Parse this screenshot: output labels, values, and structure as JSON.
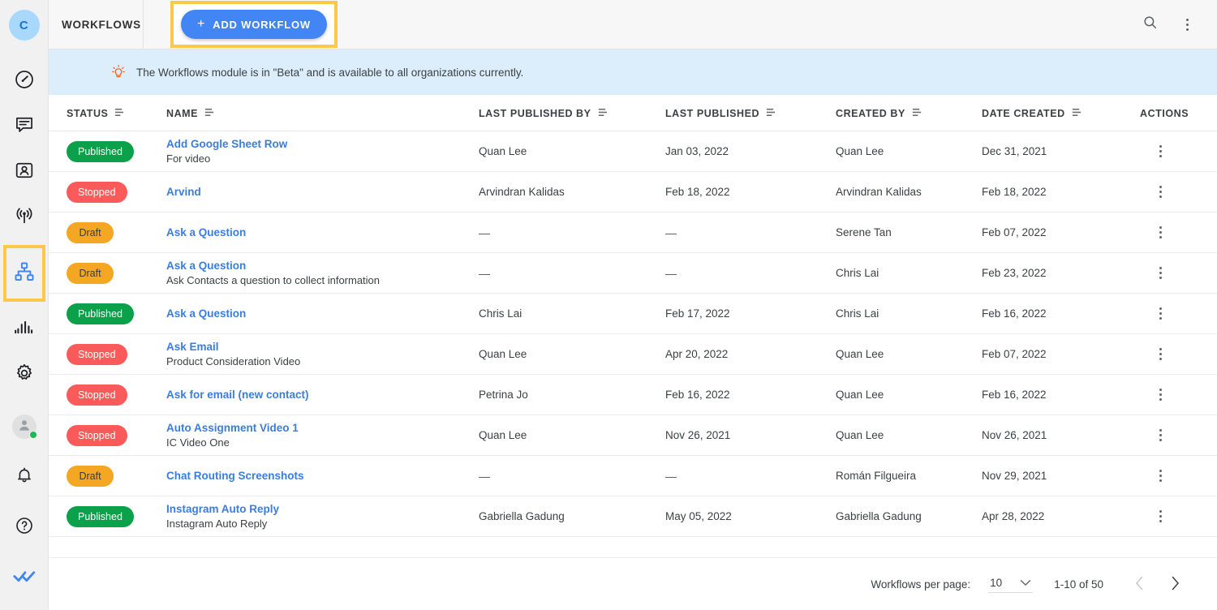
{
  "sidebar": {
    "brand_initial": "C",
    "items": [
      {
        "name": "dashboard",
        "icon": "speedometer-icon"
      },
      {
        "name": "chat",
        "icon": "message-icon"
      },
      {
        "name": "contacts",
        "icon": "contact-card-icon"
      },
      {
        "name": "broadcast",
        "icon": "antenna-icon"
      },
      {
        "name": "workflows",
        "icon": "workflow-icon",
        "active": true
      },
      {
        "name": "analytics",
        "icon": "bar-chart-icon"
      },
      {
        "name": "settings",
        "icon": "gear-icon"
      }
    ],
    "bottom_items": [
      {
        "name": "user-avatar",
        "icon": "person-icon",
        "status": "online"
      },
      {
        "name": "notifications",
        "icon": "bell-icon"
      },
      {
        "name": "help",
        "icon": "question-mark-icon"
      },
      {
        "name": "app-logo",
        "icon": "double-check-icon"
      }
    ],
    "active_highlight_color": "#fbc84a"
  },
  "header": {
    "title": "WORKFLOWS",
    "add_button_label": "ADD WORKFLOW",
    "add_button_plus": "+",
    "add_button_color": "#4285f4",
    "highlight_color": "#fbc84a",
    "search_icon": "search-icon",
    "more_icon": "more-vertical-icon"
  },
  "banner": {
    "icon": "lightbulb-icon",
    "text": "The Workflows module is in \"Beta\" and is available to all organizations currently.",
    "background": "#dceefb",
    "icon_color": "#f1662a"
  },
  "table": {
    "columns": [
      {
        "key": "status",
        "label": "STATUS",
        "sortable": true
      },
      {
        "key": "name",
        "label": "NAME",
        "sortable": true
      },
      {
        "key": "last_published_by",
        "label": "LAST PUBLISHED BY",
        "sortable": true
      },
      {
        "key": "last_published",
        "label": "LAST PUBLISHED",
        "sortable": true
      },
      {
        "key": "created_by",
        "label": "CREATED BY",
        "sortable": true
      },
      {
        "key": "date_created",
        "label": "DATE CREATED",
        "sortable": true
      },
      {
        "key": "actions",
        "label": "ACTIONS",
        "sortable": false
      }
    ],
    "rows": [
      {
        "status": "Published",
        "status_type": "published",
        "name": "Add Google Sheet Row",
        "description": "For video",
        "last_published_by": "Quan Lee",
        "last_published": "Jan 03, 2022",
        "created_by": "Quan Lee",
        "date_created": "Dec 31, 2021"
      },
      {
        "status": "Stopped",
        "status_type": "stopped",
        "name": "Arvind",
        "description": "",
        "last_published_by": "Arvindran Kalidas",
        "last_published": "Feb 18, 2022",
        "created_by": "Arvindran Kalidas",
        "date_created": "Feb 18, 2022"
      },
      {
        "status": "Draft",
        "status_type": "draft",
        "name": "Ask a Question",
        "description": "",
        "last_published_by": "—",
        "last_published": "—",
        "created_by": "Serene Tan",
        "date_created": "Feb 07, 2022"
      },
      {
        "status": "Draft",
        "status_type": "draft",
        "name": "Ask a Question",
        "description": "Ask Contacts a question to collect information",
        "last_published_by": "—",
        "last_published": "—",
        "created_by": "Chris Lai",
        "date_created": "Feb 23, 2022"
      },
      {
        "status": "Published",
        "status_type": "published",
        "name": "Ask a Question",
        "description": "",
        "last_published_by": "Chris Lai",
        "last_published": "Feb 17, 2022",
        "created_by": "Chris Lai",
        "date_created": "Feb 16, 2022"
      },
      {
        "status": "Stopped",
        "status_type": "stopped",
        "name": "Ask Email",
        "description": "Product Consideration Video",
        "last_published_by": "Quan Lee",
        "last_published": "Apr 20, 2022",
        "created_by": "Quan Lee",
        "date_created": "Feb 07, 2022"
      },
      {
        "status": "Stopped",
        "status_type": "stopped",
        "name": "Ask for email (new contact)",
        "description": "",
        "last_published_by": "Petrina Jo",
        "last_published": "Feb 16, 2022",
        "created_by": "Quan Lee",
        "date_created": "Feb 16, 2022"
      },
      {
        "status": "Stopped",
        "status_type": "stopped",
        "name": "Auto Assignment Video 1",
        "description": "IC Video One",
        "last_published_by": "Quan Lee",
        "last_published": "Nov 26, 2021",
        "created_by": "Quan Lee",
        "date_created": "Nov 26, 2021"
      },
      {
        "status": "Draft",
        "status_type": "draft",
        "name": "Chat Routing Screenshots",
        "description": "",
        "last_published_by": "—",
        "last_published": "—",
        "created_by": "Román Filgueira",
        "date_created": "Nov 29, 2021"
      },
      {
        "status": "Published",
        "status_type": "published",
        "name": "Instagram Auto Reply",
        "description": "Instagram Auto Reply",
        "last_published_by": "Gabriella Gadung",
        "last_published": "May 05, 2022",
        "created_by": "Gabriella Gadung",
        "date_created": "Apr 28, 2022"
      }
    ],
    "status_colors": {
      "published": "#0ba14a",
      "stopped": "#fb5a5a",
      "draft": "#f5a623"
    },
    "link_color": "#3b7ddd"
  },
  "pagination": {
    "per_page_label": "Workflows per page:",
    "per_page_value": "10",
    "range_label": "1-10 of 50",
    "prev_enabled": false,
    "next_enabled": true
  }
}
